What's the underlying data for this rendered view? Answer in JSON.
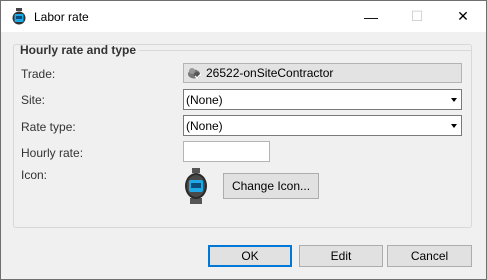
{
  "window": {
    "title": "Labor rate",
    "icon": "stopwatch-icon",
    "controls": {
      "minimize": "—",
      "maximize": "☐",
      "close": "✕"
    }
  },
  "group": {
    "title": "Hourly rate and type"
  },
  "fields": {
    "trade_label": "Trade:",
    "trade_value": "26522-onSiteContractor",
    "trade_icon": "contractor-icon",
    "site_label": "Site:",
    "site_value": "(None)",
    "rate_type_label": "Rate type:",
    "rate_type_value": "(None)",
    "hourly_rate_label": "Hourly rate:",
    "hourly_rate_value": "",
    "icon_label": "Icon:",
    "icon_value": "stopwatch-icon"
  },
  "buttons": {
    "change_icon": "Change Icon...",
    "ok": "OK",
    "edit": "Edit",
    "cancel": "Cancel"
  },
  "colors": {
    "focus_border": "#0078d7",
    "window_bg": "#f0f0f0"
  }
}
